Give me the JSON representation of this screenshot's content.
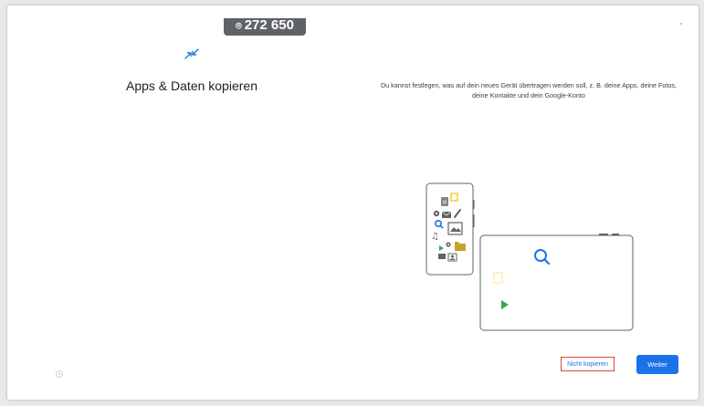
{
  "header": {
    "counter": "272 650",
    "counter_icon": "lock-icon"
  },
  "page": {
    "title": "Apps & Daten kopieren",
    "description": "Du kannst festlegen, was auf dein neues Gerät übertragen werden soll, z. B. deine Apps, deine Fotos, deine Kontakte und dein Google-Konto"
  },
  "buttons": {
    "skip_label": "Nicht kopieren",
    "next_label": "Weiter"
  },
  "colors": {
    "accent": "#1a73e8",
    "skip_border": "#e0473f",
    "pill": "#5f6266"
  }
}
